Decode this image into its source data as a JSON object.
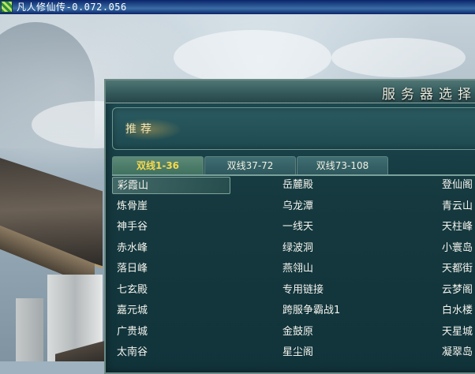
{
  "window": {
    "title": "凡人修仙传-0.072.056"
  },
  "panel": {
    "title": "服务器选择",
    "recommend_label": "推荐"
  },
  "tabs": [
    {
      "label": "双线1-36",
      "active": true
    },
    {
      "label": "双线37-72",
      "active": false
    },
    {
      "label": "双线73-108",
      "active": false
    }
  ],
  "servers": {
    "col1": [
      "彩霞山",
      "炼骨崖",
      "神手谷",
      "赤水峰",
      "落日峰",
      "七玄殿",
      "嘉元城",
      "广贵城",
      "太南谷"
    ],
    "col2": [
      "岳麓殿",
      "乌龙潭",
      "一线天",
      "绿波洞",
      "燕翎山",
      "专用链接",
      "跨服争霸战1",
      "金鼓原",
      "星尘阁"
    ],
    "col3": [
      "登仙阁",
      "青云山",
      "天柱峰",
      "小寰岛",
      "天都街",
      "云梦阁",
      "白水楼",
      "天星城",
      "凝翠岛"
    ]
  },
  "selected_server": "彩霞山"
}
